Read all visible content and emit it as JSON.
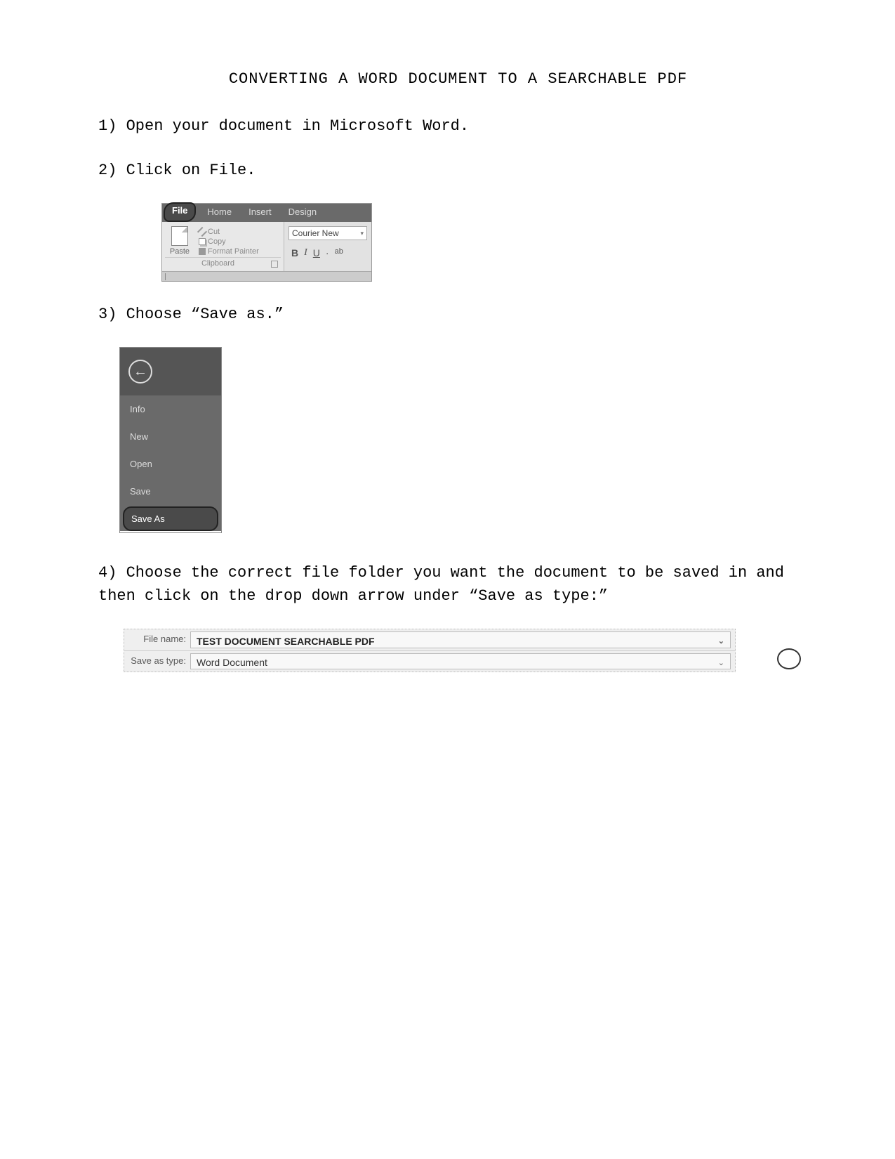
{
  "title": "CONVERTING A WORD DOCUMENT TO A SEARCHABLE PDF",
  "steps": {
    "s1_num": "1)",
    "s1_text": "Open your document in Microsoft Word.",
    "s2_num": "2)",
    "s2_text": "Click on File.",
    "s3_num": "3)",
    "s3_text": "Choose “Save as.”",
    "s4_num": "4)",
    "s4_text": "Choose the correct file folder you want the document to be saved in and then click on the drop down arrow under “Save as type:”"
  },
  "ribbon": {
    "tabs": {
      "file": "File",
      "home": "Home",
      "insert": "Insert",
      "design": "Design"
    },
    "paste": "Paste",
    "cut": "Cut",
    "copy": "Copy",
    "format_painter": "Format Painter",
    "clipboard_label": "Clipboard",
    "font_name": "Courier New",
    "b": "B",
    "i": "I",
    "u": "U",
    "ab": "ab"
  },
  "backstage": {
    "info": "Info",
    "new": "New",
    "open": "Open",
    "save": "Save",
    "save_as": "Save As"
  },
  "save_dialog": {
    "file_name_label": "File name:",
    "file_name_value": "TEST DOCUMENT SEARCHABLE PDF",
    "save_as_type_label": "Save as type:",
    "save_as_type_value": "Word Document"
  }
}
